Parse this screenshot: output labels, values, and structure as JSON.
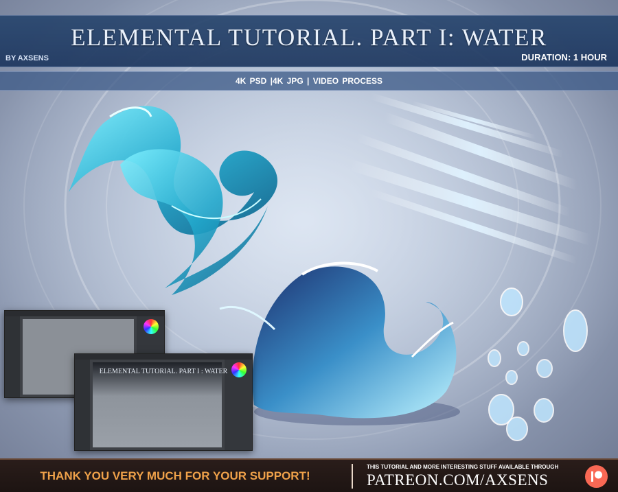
{
  "header": {
    "title": "ELEMENTAL TUTORIAL. PART I: WATER",
    "author": "BY AXSENS",
    "duration": "DURATION: 1 HOUR",
    "formats": "4K PSD   |4K JPG   |   VIDEO PROCESS"
  },
  "preview": {
    "mini_title": "ELEMENTAL TUTORIAL. PART I : WATER"
  },
  "footer": {
    "thanks": "THANK YOU VERY MUCH FOR YOUR SUPPORT!",
    "available": "THIS TUTORIAL AND MORE INTERESTING STUFF AVAILABLE THROUGH",
    "url": "PATREON.COM/AXSENS"
  },
  "colors": {
    "accent_orange": "#f0a24a",
    "patreon": "#f96854",
    "water": "#39c6e0"
  },
  "icons": [
    "patreon-logo-icon",
    "color-wheel-icon"
  ]
}
